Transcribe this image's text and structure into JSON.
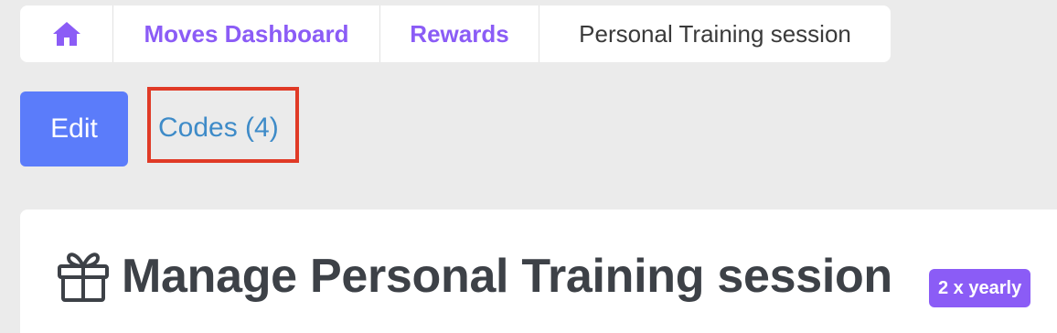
{
  "breadcrumb": {
    "home_icon": "home-icon",
    "items": [
      {
        "label": "Moves Dashboard"
      },
      {
        "label": "Rewards"
      }
    ],
    "current": "Personal Training session"
  },
  "actions": {
    "edit_label": "Edit",
    "codes_label": "Codes (4)"
  },
  "header": {
    "icon": "gift-icon",
    "title": "Manage Personal Training session",
    "badge": "2 x yearly"
  },
  "colors": {
    "accent_purple": "#8b5cf6",
    "edit_blue": "#5b7cfa",
    "link_blue": "#3e8bc8",
    "highlight_red": "#e03a26",
    "background": "#ebebeb"
  }
}
